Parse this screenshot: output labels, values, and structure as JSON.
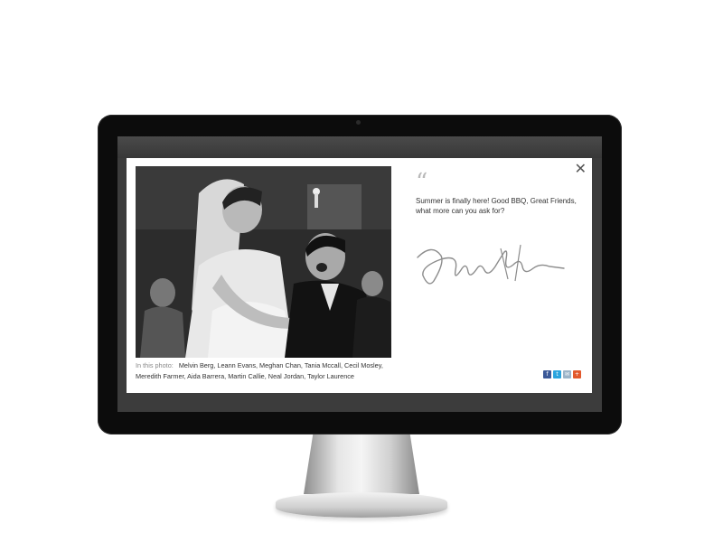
{
  "modal": {
    "close_symbol": "✕",
    "quote": {
      "mark": "“",
      "text": "Summer is finally here!  Good BBQ, Great Friends, what more can you ask for?"
    },
    "photo_caption": {
      "label": "In this photo:",
      "names": "Melvin Berg, Leann Evans, Meghan Chan, Tania Mccall, Cecil Mosley, Meredith Farmer, Aida Barrera, Martin Callie, Neal Jordan, Taylor Laurence"
    },
    "share_icons": [
      {
        "name": "facebook-icon",
        "glyph": "f",
        "color": "#3b5998"
      },
      {
        "name": "twitter-icon",
        "glyph": "t",
        "color": "#2aa4de"
      },
      {
        "name": "email-icon",
        "glyph": "✉",
        "color": "#9cb4c8"
      },
      {
        "name": "add-more-icon",
        "glyph": "+",
        "color": "#e2592c"
      }
    ]
  },
  "colors": {
    "bezel": "#0c0c0c",
    "screen_backdrop": "#3c3c3c",
    "modal_bg": "#ffffff"
  }
}
